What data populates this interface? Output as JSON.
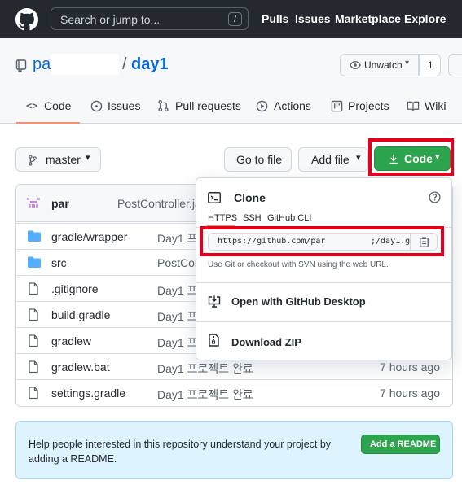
{
  "topbar": {
    "search_placeholder": "Search or jump to...",
    "search_shortcut": "/",
    "nav": [
      "Pulls",
      "Issues",
      "Marketplace",
      "Explore"
    ]
  },
  "repo": {
    "owner": "par",
    "separator": "/",
    "name": "day1",
    "watch_label": "Unwatch",
    "watch_count": "1"
  },
  "tabs": [
    {
      "label": "Code",
      "icon": "code-icon"
    },
    {
      "label": "Issues",
      "icon": "issue-icon"
    },
    {
      "label": "Pull requests",
      "icon": "pull-request-icon"
    },
    {
      "label": "Actions",
      "icon": "play-icon"
    },
    {
      "label": "Projects",
      "icon": "project-icon"
    },
    {
      "label": "Wiki",
      "icon": "book-icon"
    }
  ],
  "toolbar": {
    "branch": "master",
    "goto_file": "Go to file",
    "add_file": "Add file",
    "code": "Code"
  },
  "commit": {
    "author": "par",
    "message": "PostController.java"
  },
  "files": [
    {
      "name": "gradle/wrapper",
      "type": "folder",
      "message": "Day1 프",
      "time": ""
    },
    {
      "name": "src",
      "type": "folder",
      "message": "PostCon",
      "time": ""
    },
    {
      "name": ".gitignore",
      "type": "file",
      "message": "Day1 프",
      "time": ""
    },
    {
      "name": "build.gradle",
      "type": "file",
      "message": "Day1 프",
      "time": ""
    },
    {
      "name": "gradlew",
      "type": "file",
      "message": "Day1 프",
      "time": ""
    },
    {
      "name": "gradlew.bat",
      "type": "file",
      "message": "Day1 프로젝트 완료",
      "time": "7 hours ago"
    },
    {
      "name": "settings.gradle",
      "type": "file",
      "message": "Day1 프로젝트 완료",
      "time": "7 hours ago"
    }
  ],
  "clone": {
    "title": "Clone",
    "tabs": [
      "HTTPS",
      "SSH",
      "GitHub CLI"
    ],
    "url_start": "https://github.com/par",
    "url_end": ";/day1.g",
    "hint": "Use Git or checkout with SVN using the web URL.",
    "open_desktop": "Open with GitHub Desktop",
    "download_zip": "Download ZIP"
  },
  "readme": {
    "text": "Help people interested in this repository understand your project by adding a README.",
    "button": "Add a README"
  },
  "colors": {
    "accent_green": "#2da44e",
    "link_blue": "#0969da",
    "highlight_red": "#e3001b",
    "header_dark": "#24292f"
  }
}
